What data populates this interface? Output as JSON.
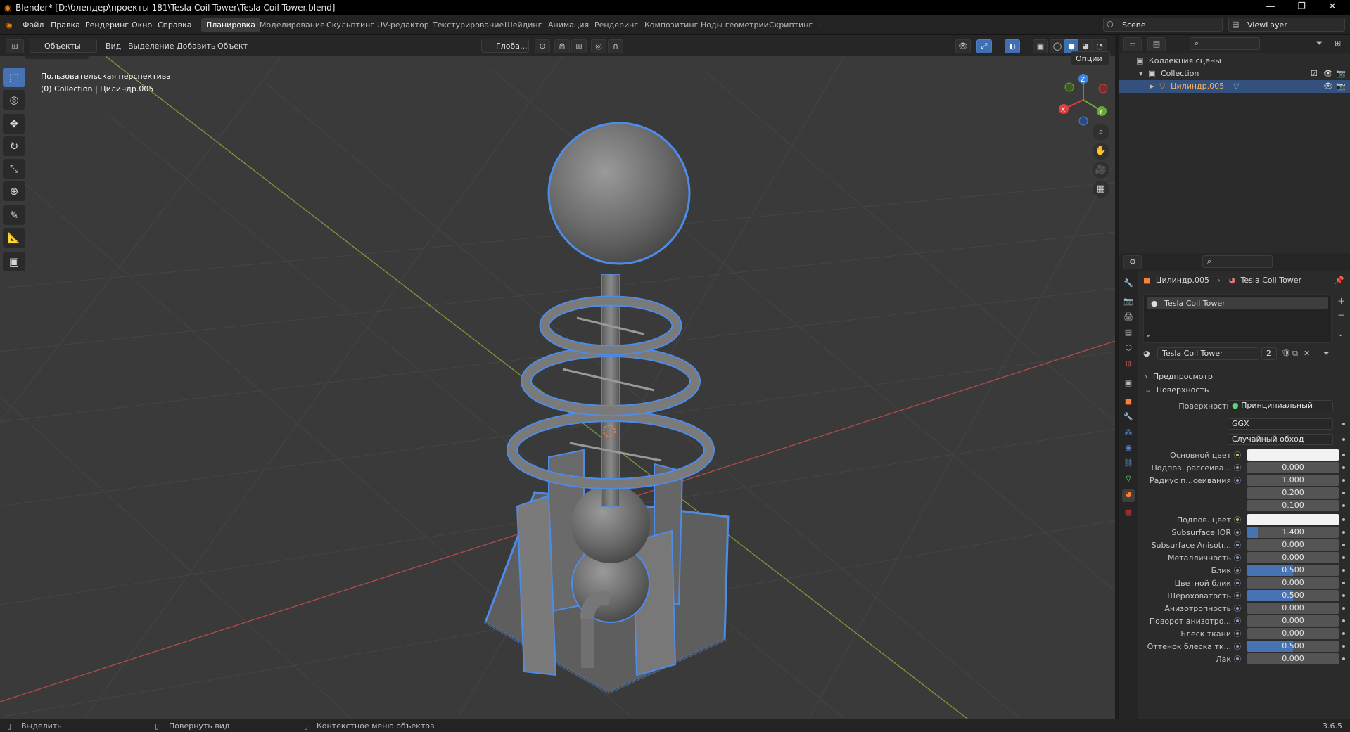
{
  "window": {
    "title": "Blender* [D:\\блендер\\проекты 181\\Tesla Coil Tower\\Tesla Coil Tower.blend]",
    "controls": [
      "—",
      "❐",
      "✕"
    ]
  },
  "menubar": {
    "items": [
      "Файл",
      "Правка",
      "Рендеринг",
      "Окно",
      "Справка"
    ],
    "workspaces": [
      "Планировка",
      "Моделирование",
      "Скульптинг",
      "UV-редактор",
      "Текстурирование",
      "Шейдинг",
      "Анимация",
      "Рендеринг",
      "Композитинг",
      "Ноды геометрии",
      "Скриптинг"
    ],
    "active_workspace": "Планировка",
    "add_tab": "+",
    "scene": "Scene",
    "view_layer": "ViewLayer"
  },
  "viewport_header": {
    "mode": "Объекты",
    "menus": [
      "Вид",
      "Выделение",
      "Добавить",
      "Объект"
    ],
    "transform_orientation": "Глоба...",
    "options_label": "Опции"
  },
  "viewport": {
    "perspective_label": "Пользовательская перспектива",
    "context_label": "(0) Collection | Цилиндр.005",
    "gizmo_axes": [
      "X",
      "Y",
      "Z"
    ]
  },
  "tools": [
    {
      "name": "select-box-tool",
      "glyph": "⬚",
      "active": true
    },
    {
      "name": "cursor-tool",
      "glyph": "◎",
      "active": false
    },
    {
      "name": "move-tool",
      "glyph": "✥",
      "active": false
    },
    {
      "name": "rotate-tool",
      "glyph": "↻",
      "active": false
    },
    {
      "name": "scale-tool",
      "glyph": "⤡",
      "active": false
    },
    {
      "name": "transform-tool",
      "glyph": "⊕",
      "active": false
    },
    {
      "name": "annotate-tool",
      "glyph": "✎",
      "active": false
    },
    {
      "name": "measure-tool",
      "glyph": "📐",
      "active": false
    },
    {
      "name": "add-cube-tool",
      "glyph": "▣",
      "active": false
    }
  ],
  "outliner": {
    "scene_collection": "Коллекция сцены",
    "collection": "Collection",
    "object": "Цилиндр.005"
  },
  "properties": {
    "breadcrumb_object": "Цилиндр.005",
    "breadcrumb_material": "Tesla Coil Tower",
    "slot_name": "Tesla Coil Tower",
    "material_name": "Tesla Coil Tower",
    "users_count": "2",
    "section_preview": "Предпросмотр",
    "section_surface": "Поверхность",
    "surface_label": "Поверхность",
    "surface_shader": "Принципиальный BSDF",
    "distribution": "GGX",
    "subsurface_method": "Случайный обход",
    "rows": [
      {
        "label": "Основной цвет",
        "kind": "color",
        "value": "#f2f2f2",
        "dot": "yellow"
      },
      {
        "label": "Подпов. рассеива...",
        "kind": "number",
        "value": "0.000",
        "fill": 0,
        "dot": "blue"
      },
      {
        "label": "Радиус п...сеивания",
        "kind": "number",
        "value": "1.000",
        "fill": 0,
        "dot": "blue"
      },
      {
        "label": "",
        "kind": "number",
        "value": "0.200",
        "fill": 0,
        "dot": "none"
      },
      {
        "label": "",
        "kind": "number",
        "value": "0.100",
        "fill": 0,
        "dot": "none"
      },
      {
        "label": "Подпов. цвет",
        "kind": "color",
        "value": "#f2f2f2",
        "dot": "yellow"
      },
      {
        "label": "Subsurface IOR",
        "kind": "number",
        "value": "1.400",
        "fill": 0.12,
        "dot": "blue"
      },
      {
        "label": "Subsurface Anisotr...",
        "kind": "number",
        "value": "0.000",
        "fill": 0,
        "dot": "blue"
      },
      {
        "label": "Металличность",
        "kind": "number",
        "value": "0.000",
        "fill": 0,
        "dot": "blue"
      },
      {
        "label": "Блик",
        "kind": "number",
        "value": "0.500",
        "fill": 0.5,
        "dot": "blue"
      },
      {
        "label": "Цветной блик",
        "kind": "number",
        "value": "0.000",
        "fill": 0,
        "dot": "blue"
      },
      {
        "label": "Шероховатость",
        "kind": "number",
        "value": "0.500",
        "fill": 0.5,
        "dot": "blue"
      },
      {
        "label": "Анизотропность",
        "kind": "number",
        "value": "0.000",
        "fill": 0,
        "dot": "blue"
      },
      {
        "label": "Поворот анизотро...",
        "kind": "number",
        "value": "0.000",
        "fill": 0,
        "dot": "blue"
      },
      {
        "label": "Блеск ткани",
        "kind": "number",
        "value": "0.000",
        "fill": 0,
        "dot": "blue"
      },
      {
        "label": "Оттенок блеска тк...",
        "kind": "number",
        "value": "0.500",
        "fill": 0.5,
        "dot": "blue"
      },
      {
        "label": "Лак",
        "kind": "number",
        "value": "0.000",
        "fill": 0,
        "dot": "blue"
      }
    ]
  },
  "statusbar": {
    "select": "Выделить",
    "rotate_view": "Повернуть вид",
    "context_menu": "Контекстное меню объектов",
    "version": "3.6.5"
  },
  "colors": {
    "accent": "#4772b3",
    "selection_outline": "#4d8ce8",
    "active_orange": "#f7813a"
  }
}
